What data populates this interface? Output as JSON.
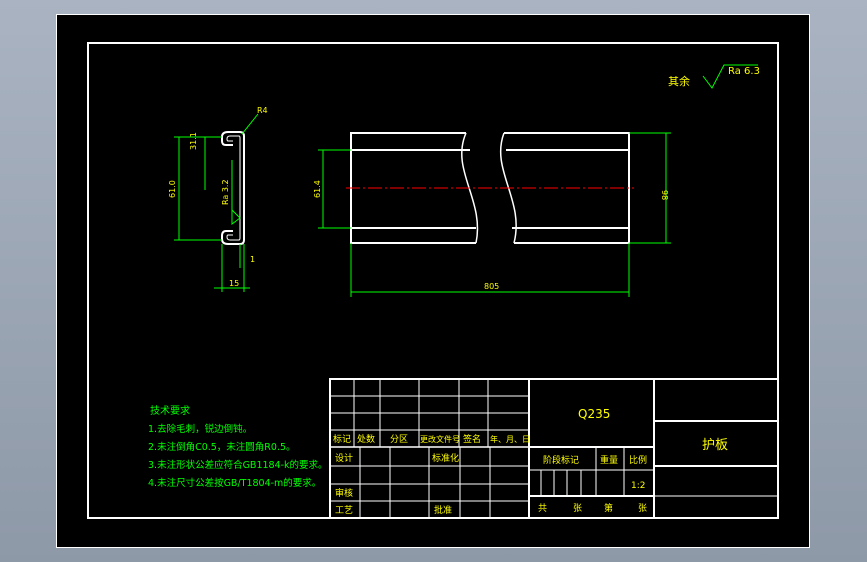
{
  "colors": {
    "background": "#000000",
    "border": "#ffffff",
    "dimension": "#00ff00",
    "centerline": "#ff0000",
    "text_yellow": "#ffff00",
    "text_green": "#00ff00",
    "window_gradient": "#a9b3c1"
  },
  "surface_note": {
    "prefix": "其余",
    "value": "Ra 6.3"
  },
  "profile_view": {
    "radius_label": "R4",
    "depth_label": "31.1",
    "height_label": "61.0",
    "roughness_label": "Ra 3.2",
    "thickness_label": "1",
    "width_label": "15"
  },
  "front_view": {
    "height_label": "61.4",
    "right_height_label": "98",
    "length_label": "805"
  },
  "tech_notes": {
    "title": "技术要求",
    "items": [
      "1.去除毛刺，锐边倒钝。",
      "2.未注倒角C0.5，未注圆角R0.5。",
      "3.未注形状公差应符合GB1184-k的要求。",
      "4.未注尺寸公差按GB/T1804-m的要求。"
    ]
  },
  "title_block": {
    "material": "Q235",
    "part_name": "护板",
    "header_cells": [
      "标记",
      "处数",
      "分区",
      "更改文件号",
      "签名",
      "年、月、日"
    ],
    "design": "设计",
    "standardize": "标准化",
    "review": "审核",
    "process": "工艺",
    "approve": "批准",
    "stage_mark": "阶段标记",
    "weight": "重量",
    "scale_label": "比例",
    "scale_value": "1:2",
    "sheets_total": "共",
    "sheet_unit": "张",
    "sheet_no": "第",
    "sheet_unit2": "张"
  }
}
